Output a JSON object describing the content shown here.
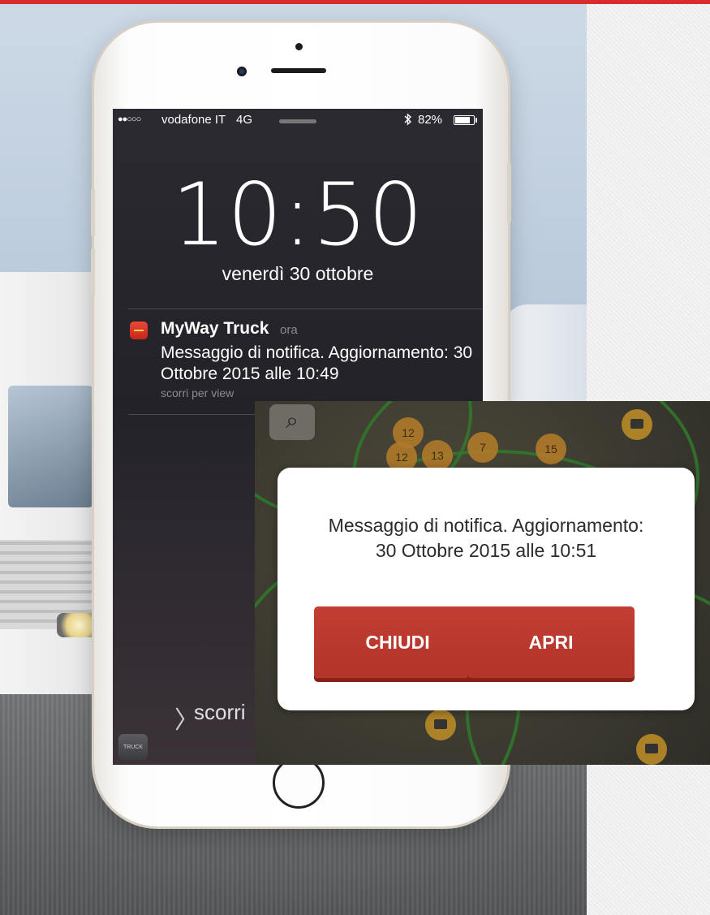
{
  "status_bar": {
    "signal": "●●○○○",
    "carrier": "vodafone IT",
    "network": "4G",
    "bluetooth_icon": "bluetooth-icon",
    "battery_percent": "82%",
    "battery_level": 0.82
  },
  "lock_screen": {
    "time": "10:50",
    "date": "venerdì 30 ottobre",
    "slide_chevron": "〉",
    "slide_text": "scorri"
  },
  "notification": {
    "app_name": "MyWay Truck",
    "time": "ora",
    "body": "Messaggio di notifica. Aggiornamento: 30 Ottobre 2015 alle 10:49",
    "hint": "scorri per view"
  },
  "camera_shortcut": {
    "label": "TRUCK"
  },
  "map": {
    "search_icon": "⌕",
    "clusters": [
      "12",
      "12",
      "13",
      "7",
      "15"
    ]
  },
  "dialog": {
    "message_line1": "Messaggio di notifica. Aggiornamento:",
    "message_line2": "30 Ottobre 2015 alle 10:51",
    "close_label": "CHIUDI",
    "open_label": "APRI"
  },
  "colors": {
    "accent_red": "#b3342a",
    "map_roads": "#2f7a2b",
    "map_pins": "#b07a2a"
  }
}
